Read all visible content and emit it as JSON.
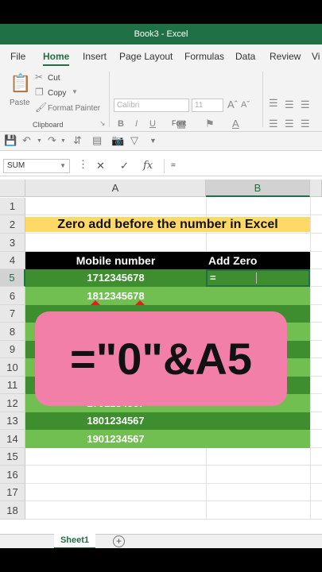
{
  "window": {
    "title": "Book3  -  Excel"
  },
  "ribbon_tabs": [
    "File",
    "Home",
    "Insert",
    "Page Layout",
    "Formulas",
    "Data",
    "Review",
    "Vi"
  ],
  "ribbon": {
    "clipboard": {
      "paste": "Paste",
      "cut": "Cut",
      "copy": "Copy",
      "format_painter": "Format Painter",
      "label": "Clipboard"
    },
    "font": {
      "name": "Calibri",
      "size": "11",
      "bold": "B",
      "italic": "I",
      "underline": "U",
      "label": "Font"
    }
  },
  "formula_bar": {
    "name_box": "SUM",
    "formula": "="
  },
  "columns": [
    "A",
    "B"
  ],
  "rows": [
    "1",
    "2",
    "3",
    "4",
    "5",
    "6",
    "7",
    "8",
    "9",
    "10",
    "11",
    "12",
    "13",
    "14",
    "15",
    "16",
    "17",
    "18"
  ],
  "sheet": {
    "title": "Zero add before the number in Excel",
    "header_a": "Mobile number",
    "header_b": "Add Zero",
    "editing_b5": "=",
    "numbers": [
      "1712345678",
      "1812345678",
      "",
      "",
      "",
      "",
      "",
      "1701234567",
      "1801234567",
      "1901234567"
    ]
  },
  "overlay_formula": "=\"0\"&A5",
  "sheet_tabs": {
    "active": "Sheet1",
    "add": "+"
  },
  "colors": {
    "excel_green": "#1f7145",
    "title_fill": "#ffd966",
    "header_fill": "#000000",
    "band_dark": "#3e8e2f",
    "band_light": "#70bf50",
    "overlay_pink": "#f17fa8"
  }
}
